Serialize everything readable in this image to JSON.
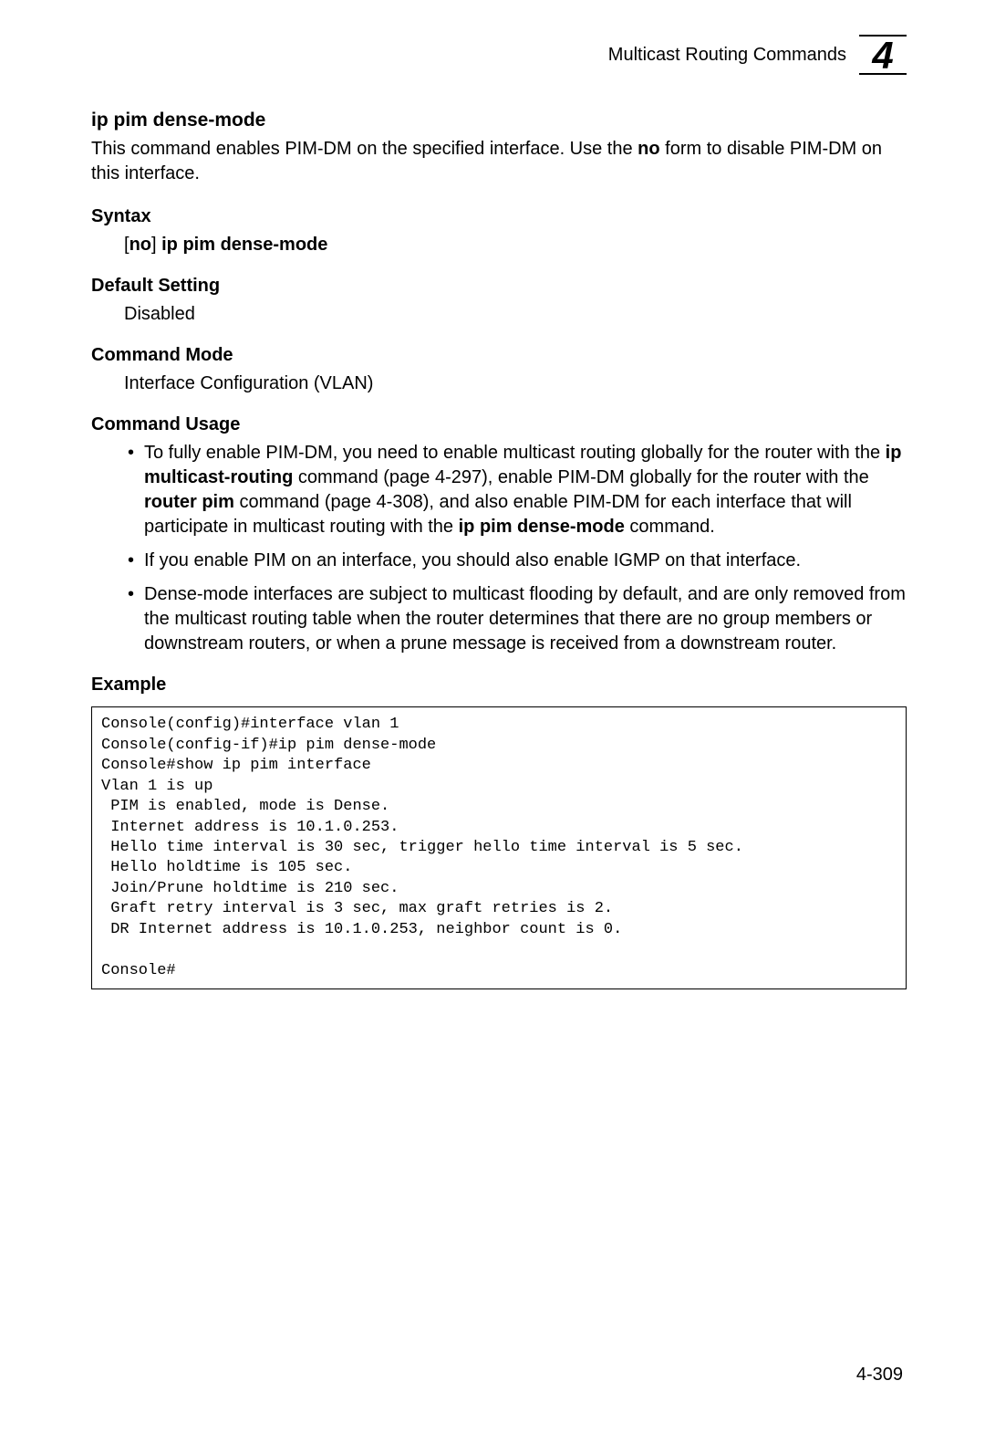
{
  "header": {
    "section_title": "Multicast Routing Commands",
    "chapter_number": "4"
  },
  "command": {
    "name": "ip pim dense-mode",
    "description_parts": {
      "p1": "This command enables PIM-DM on the specified interface. Use the ",
      "no_bold": "no",
      "p2": " form to disable PIM-DM on this interface."
    }
  },
  "sections": {
    "syntax": {
      "label": "Syntax",
      "text_parts": {
        "open_bracket": "[",
        "no_bold": "no",
        "close_bracket": "] ",
        "cmd_bold": "ip pim dense-mode"
      }
    },
    "default_setting": {
      "label": "Default Setting",
      "value": "Disabled"
    },
    "command_mode": {
      "label": "Command Mode",
      "value": "Interface Configuration (VLAN)"
    },
    "command_usage": {
      "label": "Command Usage",
      "items": [
        {
          "p1": "To fully enable PIM-DM, you need to enable multicast routing globally for the router with the ",
          "b1": "ip multicast-routing",
          "p2": " command (page 4-297), enable PIM-DM globally for the router with the ",
          "b2": "router pim",
          "p3": " command (page 4-308), and also enable PIM-DM for each interface that will participate in multicast routing with the ",
          "b3": "ip pim dense-mode",
          "p4": " command."
        },
        {
          "p1": "If you enable PIM on an interface, you should also enable IGMP on that interface."
        },
        {
          "p1": "Dense-mode interfaces are subject to multicast flooding by default, and are only removed from the multicast routing table when the router determines that there are no group members or downstream routers, or when a prune message is received from a downstream router."
        }
      ]
    },
    "example": {
      "label": "Example",
      "code": "Console(config)#interface vlan 1\nConsole(config-if)#ip pim dense-mode\nConsole#show ip pim interface\nVlan 1 is up\n PIM is enabled, mode is Dense.\n Internet address is 10.1.0.253.\n Hello time interval is 30 sec, trigger hello time interval is 5 sec.\n Hello holdtime is 105 sec.\n Join/Prune holdtime is 210 sec.\n Graft retry interval is 3 sec, max graft retries is 2.\n DR Internet address is 10.1.0.253, neighbor count is 0.\n\nConsole#"
    }
  },
  "page_number": "4-309"
}
